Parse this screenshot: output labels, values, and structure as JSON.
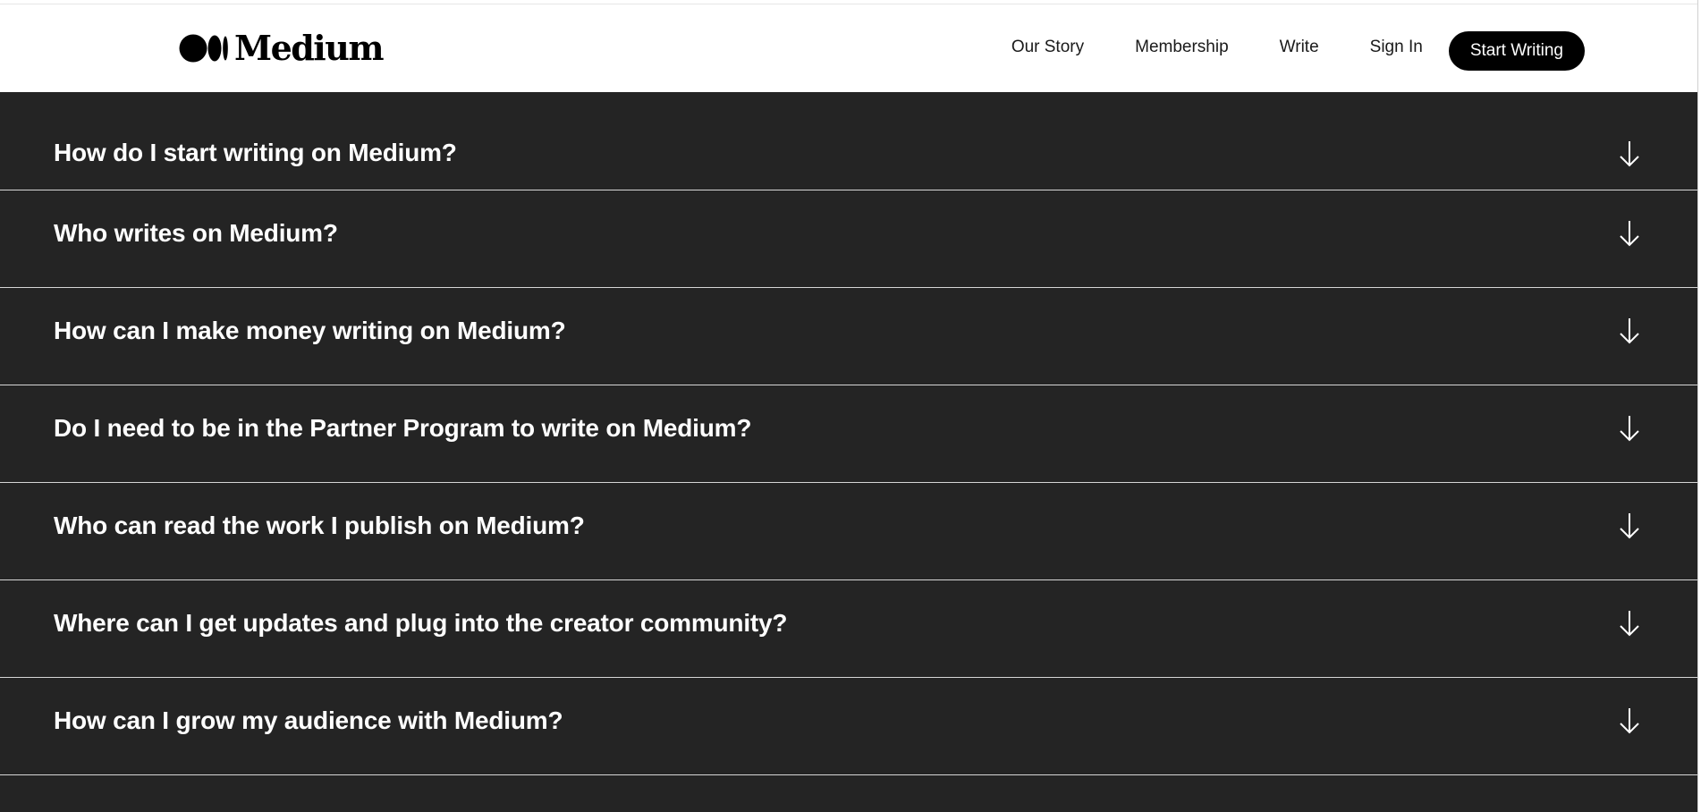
{
  "header": {
    "logo_text": "Medium",
    "logo_icon": "medium-logo-icon",
    "nav": [
      {
        "label": "Our Story"
      },
      {
        "label": "Membership"
      },
      {
        "label": "Write"
      },
      {
        "label": "Sign In"
      }
    ],
    "cta_label": "Start Writing"
  },
  "faq": {
    "items": [
      {
        "question": "How do I start writing on Medium?",
        "icon": "arrow-down-icon"
      },
      {
        "question": "Who writes on Medium?",
        "icon": "arrow-down-icon"
      },
      {
        "question": "How can I make money writing on Medium?",
        "icon": "arrow-down-icon"
      },
      {
        "question": "Do I need to be in the Partner Program to write on Medium?",
        "icon": "arrow-down-icon"
      },
      {
        "question": "Who can read the work I publish on Medium?",
        "icon": "arrow-down-icon"
      },
      {
        "question": "Where can I get updates and plug into the creator community?",
        "icon": "arrow-down-icon"
      },
      {
        "question": "How can I grow my audience with Medium?",
        "icon": "arrow-down-icon"
      }
    ]
  },
  "colors": {
    "faq_background": "#242424",
    "cta_background": "#000000",
    "divider": "#d6d6d6"
  }
}
